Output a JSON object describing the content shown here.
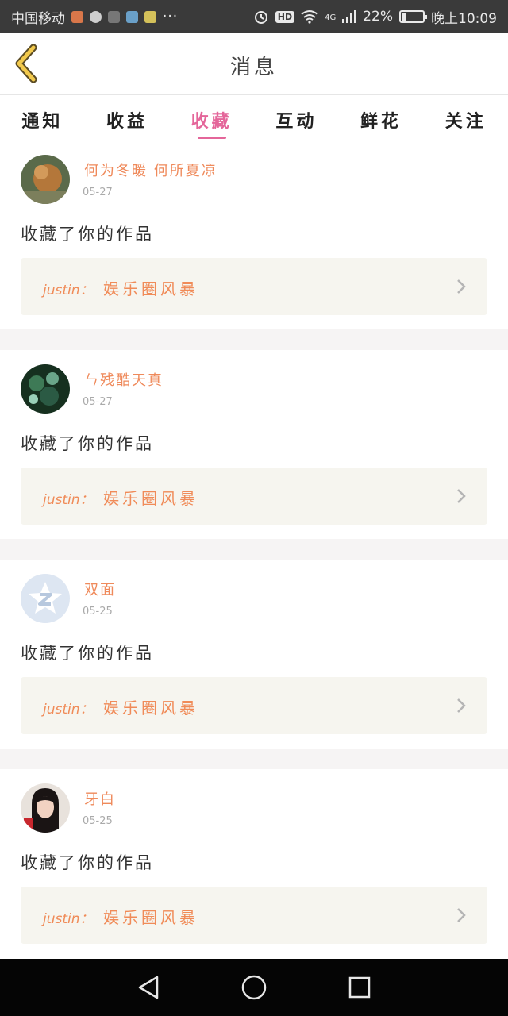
{
  "status_bar": {
    "carrier": "中国移动",
    "more": "···",
    "hd": "HD",
    "network": "4G",
    "battery": "22%",
    "battery_level": 0.22,
    "time": "晚上10:09"
  },
  "header": {
    "title": "消息"
  },
  "tabs": [
    {
      "label": "通知",
      "active": false
    },
    {
      "label": "收益",
      "active": false
    },
    {
      "label": "收藏",
      "active": true
    },
    {
      "label": "互动",
      "active": false
    },
    {
      "label": "鲜花",
      "active": false
    },
    {
      "label": "关注",
      "active": false
    }
  ],
  "items": [
    {
      "username": "何为冬暖 何所夏凉",
      "date": "05-27",
      "action": "收藏了你的作品",
      "work_author": "justin：",
      "work_title": "娱乐圈风暴"
    },
    {
      "username": "ㄣ残酷天真",
      "date": "05-27",
      "action": "收藏了你的作品",
      "work_author": "justin：",
      "work_title": "娱乐圈风暴"
    },
    {
      "username": "双面",
      "date": "05-25",
      "action": "收藏了你的作品",
      "work_author": "justin：",
      "work_title": "娱乐圈风暴"
    },
    {
      "username": "牙白",
      "date": "05-25",
      "action": "收藏了你的作品",
      "work_author": "justin：",
      "work_title": "娱乐圈风暴"
    }
  ],
  "colors": {
    "accent": "#e4669a",
    "username": "#ef8a5b",
    "work_box_bg": "#f6f5ef"
  }
}
